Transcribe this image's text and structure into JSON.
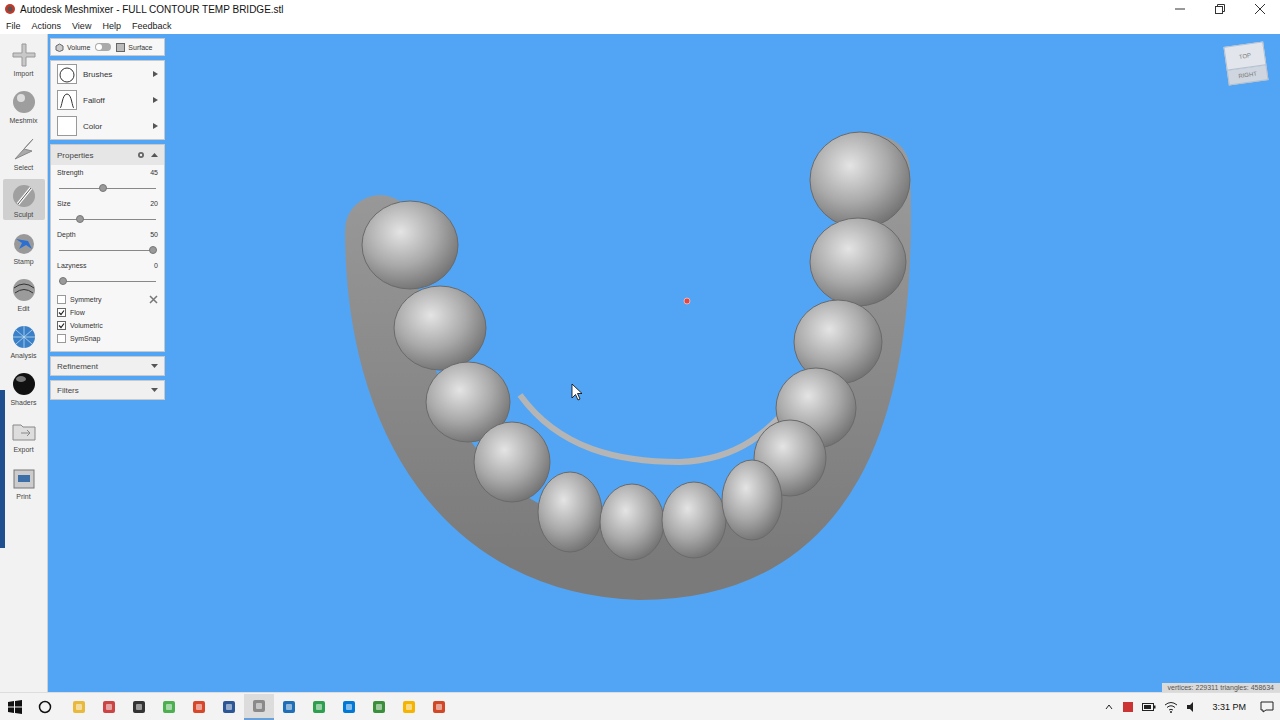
{
  "window": {
    "title": "Autodesk Meshmixer - FULL CONTOUR TEMP BRIDGE.stl"
  },
  "menu": [
    "File",
    "Actions",
    "View",
    "Help",
    "Feedback"
  ],
  "toolbar": [
    {
      "label": "Import",
      "selected": false
    },
    {
      "label": "Meshmix",
      "selected": false
    },
    {
      "label": "Select",
      "selected": false
    },
    {
      "label": "Sculpt",
      "selected": true
    },
    {
      "label": "Stamp",
      "selected": false
    },
    {
      "label": "Edit",
      "selected": false
    },
    {
      "label": "Analysis",
      "selected": false
    },
    {
      "label": "Shaders",
      "selected": false
    },
    {
      "label": "Export",
      "selected": false
    },
    {
      "label": "Print",
      "selected": false
    }
  ],
  "mode_toggle": {
    "left": "Volume",
    "right": "Surface",
    "on": false
  },
  "tool_menus": [
    "Brushes",
    "Falloff",
    "Color"
  ],
  "properties": {
    "title": "Properties",
    "expanded": true,
    "sliders": [
      {
        "label": "Strength",
        "value": "45",
        "level": 0.45
      },
      {
        "label": "Size",
        "value": "20",
        "level": 0.22
      },
      {
        "label": "Depth",
        "value": "50",
        "level": 0.97
      },
      {
        "label": "Lazyness",
        "value": "0",
        "level": 0.04
      }
    ],
    "checkboxes": [
      {
        "label": "Symmetry",
        "checked": false
      },
      {
        "label": "Flow",
        "checked": true
      },
      {
        "label": "Volumetric",
        "checked": true
      },
      {
        "label": "SymSnap",
        "checked": false
      }
    ]
  },
  "sections": [
    {
      "title": "Refinement",
      "expanded": false
    },
    {
      "title": "Filters",
      "expanded": false
    }
  ],
  "viewcube": {
    "top": "TOP",
    "right": "RIGHT"
  },
  "status": "vertices: 229311 triangles: 458634",
  "taskbar": {
    "time": "3:31 PM"
  }
}
